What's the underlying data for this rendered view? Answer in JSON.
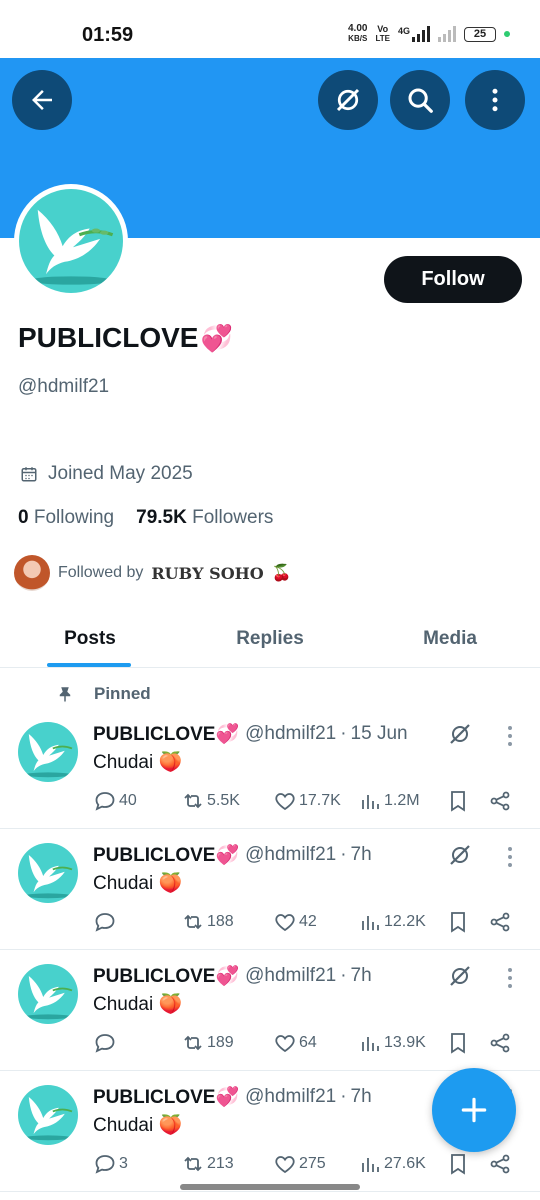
{
  "status_bar": {
    "time": "01:59",
    "net_speed_value": "4.00",
    "net_speed_unit": "KB/S",
    "volte_top": "Vo",
    "volte_bottom": "LTE",
    "network": "4G",
    "battery": "25"
  },
  "header": {
    "back_icon": "back-arrow-icon",
    "grok_icon": "grok-icon",
    "search_icon": "search-icon",
    "more_icon": "more-vertical-icon",
    "banner_color": "#2196f3"
  },
  "profile": {
    "display_name": "PUBLICLOVE",
    "name_emoji": "💞",
    "handle": "@hdmilf21",
    "joined": "Joined May 2025",
    "following_count": "0",
    "following_label": "Following",
    "followers_count": "79.5K",
    "followers_label": "Followers",
    "followed_by_label": "Followed by",
    "followed_by_name": "𝐑𝐔𝐁𝐘 𝐒𝐎𝐇𝐎",
    "followed_by_emoji": "🍒",
    "follow_button": "Follow"
  },
  "tabs": [
    {
      "label": "Posts",
      "active": true
    },
    {
      "label": "Replies",
      "active": false
    },
    {
      "label": "Media",
      "active": false
    }
  ],
  "pinned_label": "Pinned",
  "posts": [
    {
      "name": "PUBLICLOVE💞",
      "handle": "@hdmilf21",
      "time": "15 Jun",
      "text": "Chudai 🍑",
      "replies": "40",
      "reposts": "5.5K",
      "likes": "17.7K",
      "views": "1.2M"
    },
    {
      "name": "PUBLICLOVE💞",
      "handle": "@hdmilf21",
      "time": "7h",
      "text": "Chudai 🍑",
      "replies": "",
      "reposts": "188",
      "likes": "42",
      "views": "12.2K"
    },
    {
      "name": "PUBLICLOVE💞",
      "handle": "@hdmilf21",
      "time": "7h",
      "text": "Chudai 🍑",
      "replies": "",
      "reposts": "189",
      "likes": "64",
      "views": "13.9K"
    },
    {
      "name": "PUBLICLOVE💞",
      "handle": "@hdmilf21",
      "time": "7h",
      "text": "Chudai 🍑",
      "replies": "3",
      "reposts": "213",
      "likes": "275",
      "views": "27.6K"
    }
  ],
  "accent_color": "#1d9bf0"
}
